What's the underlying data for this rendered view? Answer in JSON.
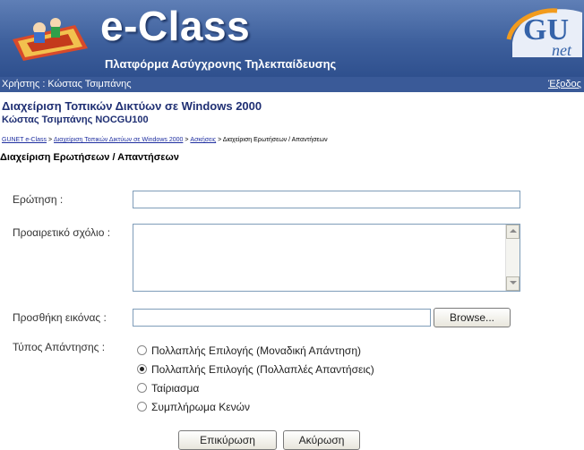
{
  "header": {
    "logo_text": "e-Class",
    "subtitle": "Πλατφόρμα Ασύγχρονης Τηλεκπαίδευσης",
    "partner_logo_primary": "GU",
    "partner_logo_secondary": "net"
  },
  "userbar": {
    "user": "Χρήστης : Κώστας Τσιμπάνης",
    "logout": "Έξοδος"
  },
  "course": {
    "title": "Διαχείριση Τοπικών Δικτύων σε Windows 2000",
    "subtitle": "Κώστας Τσιμπάνης NOCGU100"
  },
  "breadcrumb": {
    "items": [
      "GUNET e-Class",
      "Διαχείριση Τοπικών Δικτύων σε Windows 2000",
      "Ασκήσεις"
    ],
    "current": "Διαχείριση Ερωτήσεων / Απαντήσεων",
    "separator": ">"
  },
  "page": {
    "title": "Διαχείριση Ερωτήσεων / Απαντήσεων"
  },
  "form": {
    "question_label": "Ερώτηση :",
    "question_value": "",
    "comment_label": "Προαιρετικό σχόλιο :",
    "comment_value": "",
    "image_label": "Προσθήκη εικόνας :",
    "image_value": "",
    "browse_label": "Browse...",
    "answer_type_label": "Τύπος Απάντησης :",
    "answer_types": [
      {
        "label": "Πολλαπλής Επιλογής (Μοναδική Απάντηση)",
        "checked": false
      },
      {
        "label": "Πολλαπλής Επιλογής (Πολλαπλές Απαντήσεις)",
        "checked": true
      },
      {
        "label": "Ταίριασμα",
        "checked": false
      },
      {
        "label": "Συμπλήρωμα Κενών",
        "checked": false
      }
    ],
    "submit_label": "Επικύρωση",
    "cancel_label": "Ακύρωση"
  }
}
